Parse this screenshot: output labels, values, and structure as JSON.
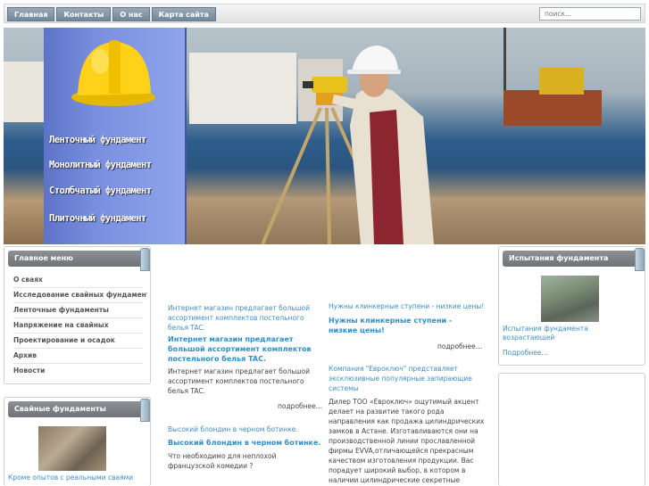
{
  "nav": {
    "items": [
      "Главная",
      "Контакты",
      "О нас",
      "Карта сайта"
    ],
    "search_placeholder": "поиск..."
  },
  "banner": {
    "links": [
      "Ленточный фундамент",
      "Монолитный фундамент",
      "Столбчатый фундамент",
      "Плиточный фундамент"
    ]
  },
  "main_menu": {
    "title": "Главное меню",
    "items": [
      "О сваях",
      "Исследование свайных фундаментов",
      "Ленточные фундаменты",
      "Напряжение на свайных",
      "Проектирование и осадок",
      "Архив",
      "Новости"
    ]
  },
  "pile_box": {
    "title": "Свайные фундаменты",
    "caption": "Кроме опытов с реальными сваями"
  },
  "right_box": {
    "title": "Испытания фундамента",
    "caption": "Испытания фундамента возрастающей",
    "more": "Подробнее…"
  },
  "col1": {
    "a1_link": "Интернет магазин предлагает большой ассортимент комплектов постельного белья TAC.",
    "a1_title": "Интернет магазин предлагает большой ассортимент комплектов постельного белья TAC.",
    "a1_body": "Интернет магазин предлагает большой ассортимент комплектов постельного белья TAC.",
    "a1_more": "подробнее…",
    "a2_link": "Высокий блондин в черном ботинке.",
    "a2_title": "Высокий блондин в черном ботинке.",
    "a2_body": "Что необходимо для неплохой французской комедии ?"
  },
  "col2": {
    "a1_link": "Нужны клинкерные ступени - низкие цены!",
    "a1_title": "Нужны клинкерные ступени - низкие цены!",
    "a1_more": "подробнее…",
    "a2_link": "Компания \"Евроключ\" представляет эксклюзивные популярные запирающие системы",
    "a2_body": "Дилер ТОО «Евроключ» ощутимый акцент делает на развитие такого рода направления как продажа цилиндрических замков в Астане. Изготавливаются они на производственной линии прославленной фирмы EVVA,отличающейся прекрасным качеством изготовления продукции. Вас порадует широкий выбор, в котором в наличии цилиндрические секретные механизмы, изготовленные согласно"
  }
}
